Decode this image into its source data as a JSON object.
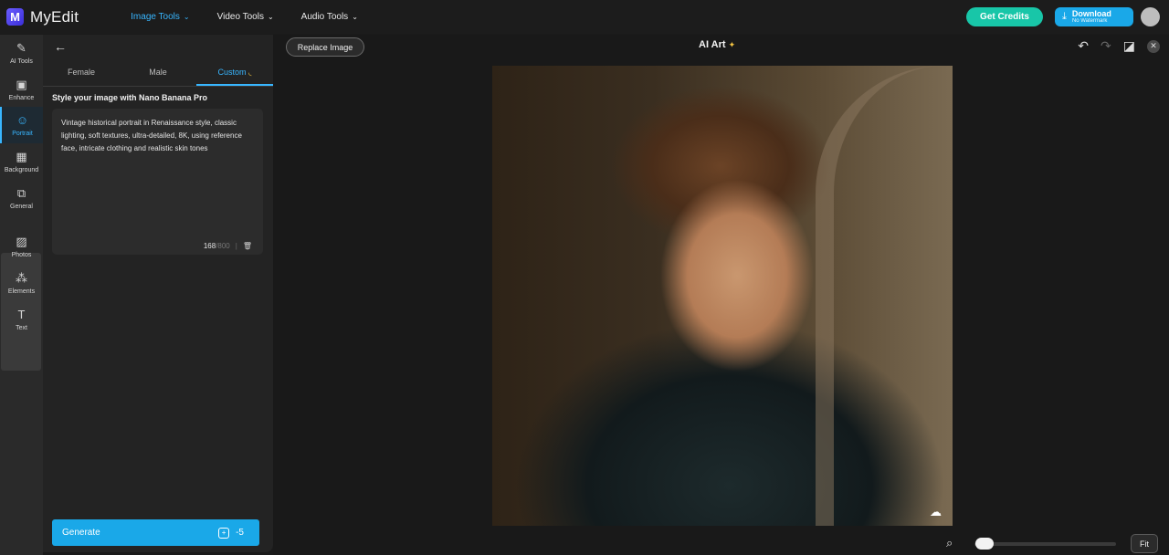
{
  "app": {
    "name": "MyEdit"
  },
  "nav": [
    {
      "label": "Image Tools",
      "active": true
    },
    {
      "label": "Video Tools",
      "active": false
    },
    {
      "label": "Audio Tools",
      "active": false
    }
  ],
  "header": {
    "credits_label": "Get Credits",
    "download_label": "Download",
    "download_sub": "No Watermark"
  },
  "rail": [
    {
      "label": "AI Tools",
      "icon": "magic-wand-icon",
      "glyph": "✎"
    },
    {
      "label": "Enhance",
      "icon": "image-enhance-icon",
      "glyph": "▣"
    },
    {
      "label": "Portrait",
      "icon": "portrait-icon",
      "glyph": "☺",
      "active": true
    },
    {
      "label": "Background",
      "icon": "background-icon",
      "glyph": "▦"
    },
    {
      "label": "General",
      "icon": "general-icon",
      "glyph": "⧉"
    },
    {
      "label": "Photos",
      "icon": "photos-icon",
      "glyph": "▨"
    },
    {
      "label": "Elements",
      "icon": "elements-icon",
      "glyph": "⁂"
    },
    {
      "label": "Text",
      "icon": "text-icon",
      "glyph": "T"
    }
  ],
  "panel": {
    "tabs": [
      {
        "label": "Female"
      },
      {
        "label": "Male"
      },
      {
        "label": "Custom",
        "active": true
      }
    ],
    "section_title": "Style your image with Nano Banana Pro",
    "prompt": "Vintage historical portrait in Renaissance style, classic lighting, soft textures, ultra-detailed, 8K, using reference face, intricate clothing and realistic skin tones",
    "char_count": "168",
    "char_max": "/800",
    "generate_label": "Generate",
    "generate_cost": "-5"
  },
  "workspace": {
    "replace_label": "Replace Image",
    "title": "AI Art",
    "fit_label": "Fit"
  },
  "zoom": {
    "level": 0.02
  }
}
